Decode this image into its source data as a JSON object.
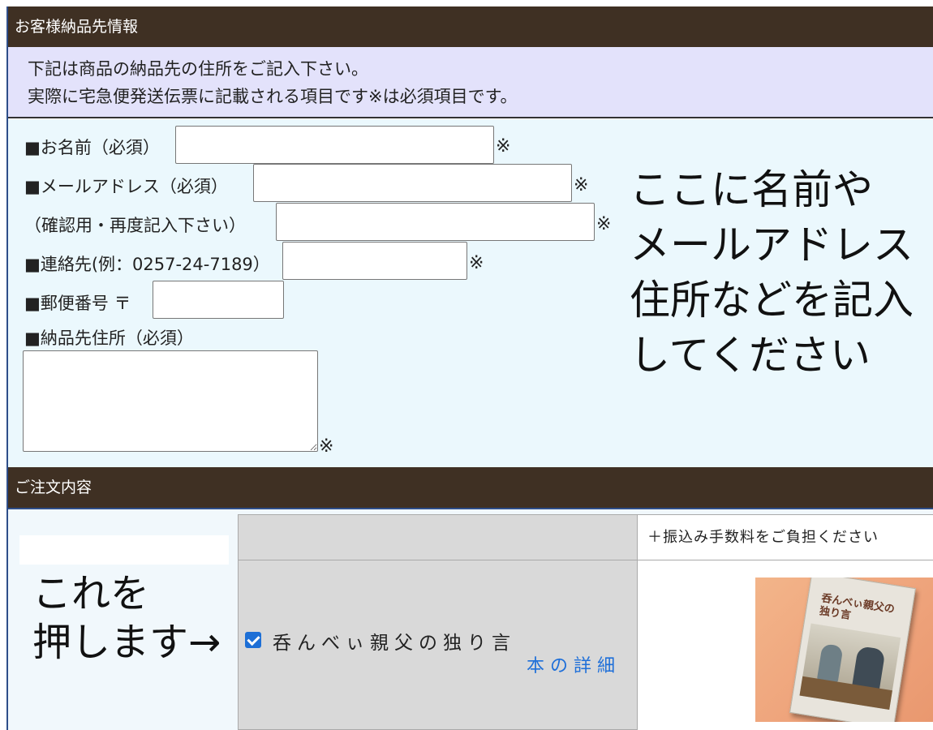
{
  "sections": {
    "delivery_header": "お客様納品先情報",
    "order_header": "ご注文内容"
  },
  "notice": {
    "line1": "下記は商品の納品先の住所をご記入下さい。",
    "line2": "実際に宅急便発送伝票に記載される項目です※は必須項目です。"
  },
  "form": {
    "required_mark": "※",
    "name_label": "■お名前（必須）",
    "email_label": "■メールアドレス（必須）",
    "email_confirm_label": "（確認用・再度記入下さい）",
    "phone_label": "■連絡先(例：0257-24-7189）",
    "postal_label": "■郵便番号 〒",
    "address_label": "■納品先住所（必須）",
    "name_value": "",
    "email_value": "",
    "email_confirm_value": "",
    "phone_value": "",
    "postal_value": "",
    "address_value": ""
  },
  "annotation": {
    "line1": "ここに名前や",
    "line2": "メールアドレス",
    "line3": "住所などを記入",
    "line4": "してください"
  },
  "order": {
    "push_line1": "これを",
    "push_line2": "押します→",
    "fee_note": "＋振込み手数料をご負担ください",
    "product_name": "呑んべぃ親父の独り言",
    "product_checked": true,
    "detail_link": "本の詳細",
    "book_cover_title_line1": "呑んべぃ親父の",
    "book_cover_title_line2": "独り言"
  },
  "colors": {
    "header_bg": "#3f3023",
    "notice_bg": "#e3e2fb",
    "form_bg": "#ebf8fd",
    "link": "#1e6fd9",
    "checkbox": "#1d6fd6"
  }
}
